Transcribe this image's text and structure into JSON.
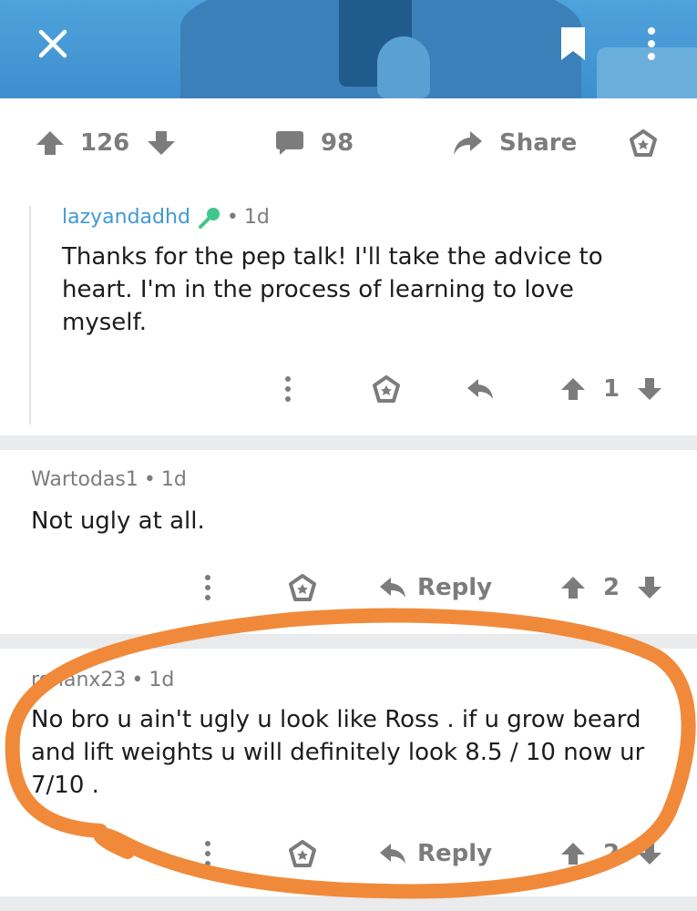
{
  "colors": {
    "accent_blue": "#3f9ad6",
    "muted_gray": "#7c7c7c",
    "annotation_orange": "#f08a3a",
    "divider": "#e9ebed"
  },
  "header": {
    "close_icon": "close-icon",
    "bookmark_icon": "bookmark-icon",
    "more_icon": "more-vertical-icon"
  },
  "post_bar": {
    "score": "126",
    "comments": "98",
    "share_label": "Share"
  },
  "comments": [
    {
      "author": "lazyandadhd",
      "author_badge_icon": "microphone-icon",
      "age": "1d",
      "text": "Thanks for the pep talk! I'll take the advice to heart. I'm in the process of learning to love myself.",
      "score": "1"
    },
    {
      "author": "Wartodas1",
      "age": "1d",
      "text": "Not ugly at all.",
      "reply_label": "Reply",
      "score": "2"
    },
    {
      "author": "rohanx23",
      "age": "1d",
      "text": "No bro u ain't ugly u look like Ross .  if u grow beard and lift weights u will definitely look 8.5 / 10 now ur 7/10 .",
      "reply_label": "Reply",
      "score": "2"
    }
  ]
}
